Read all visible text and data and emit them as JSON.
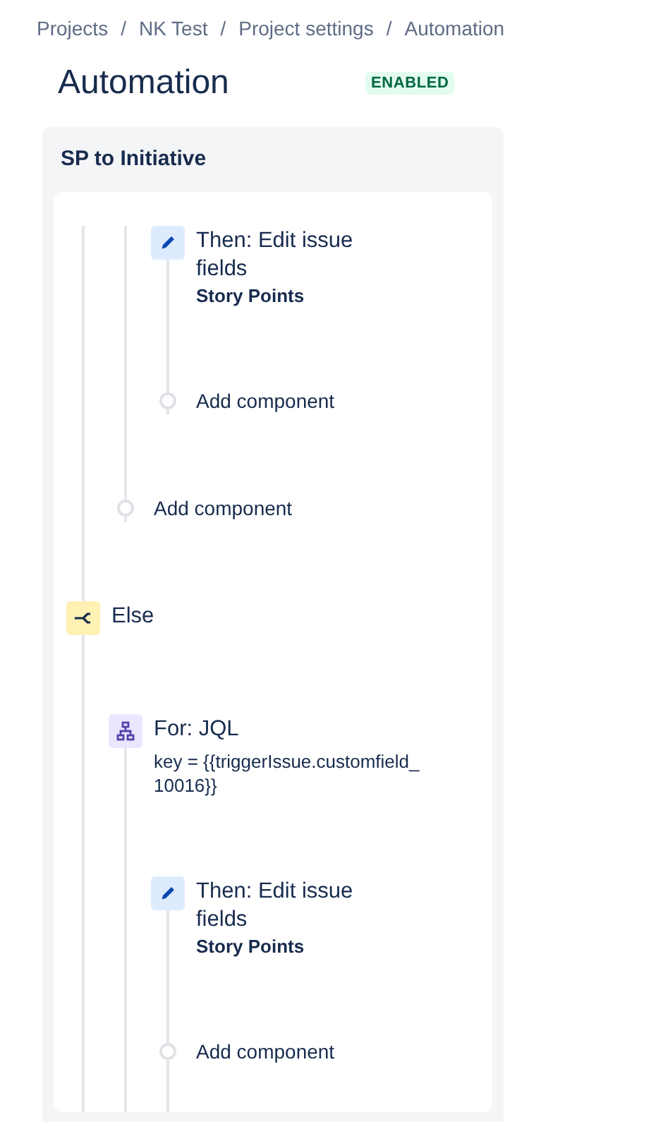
{
  "breadcrumbs": [
    "Projects",
    "NK Test",
    "Project settings",
    "Automation"
  ],
  "breadcrumb_separator": "/",
  "page_title": "Automation",
  "status_badge": "ENABLED",
  "rule": {
    "name": "SP to Initiative",
    "components": [
      {
        "kind": "container",
        "children": [
          {
            "kind": "container",
            "children": [
              {
                "kind": "action",
                "title": "Then: Edit issue fields",
                "detail": "Story Points"
              },
              {
                "kind": "add",
                "label": "Add component"
              }
            ]
          },
          {
            "kind": "add",
            "label": "Add component"
          }
        ]
      },
      {
        "kind": "else",
        "title": "Else",
        "children": [
          {
            "kind": "branch",
            "title": "For: JQL",
            "detail": "key = {{triggerIssue.customfield_ 10016}}",
            "children": [
              {
                "kind": "action",
                "title": "Then: Edit issue fields",
                "detail": "Story Points"
              },
              {
                "kind": "add",
                "label": "Add component"
              }
            ]
          }
        ]
      }
    ]
  }
}
